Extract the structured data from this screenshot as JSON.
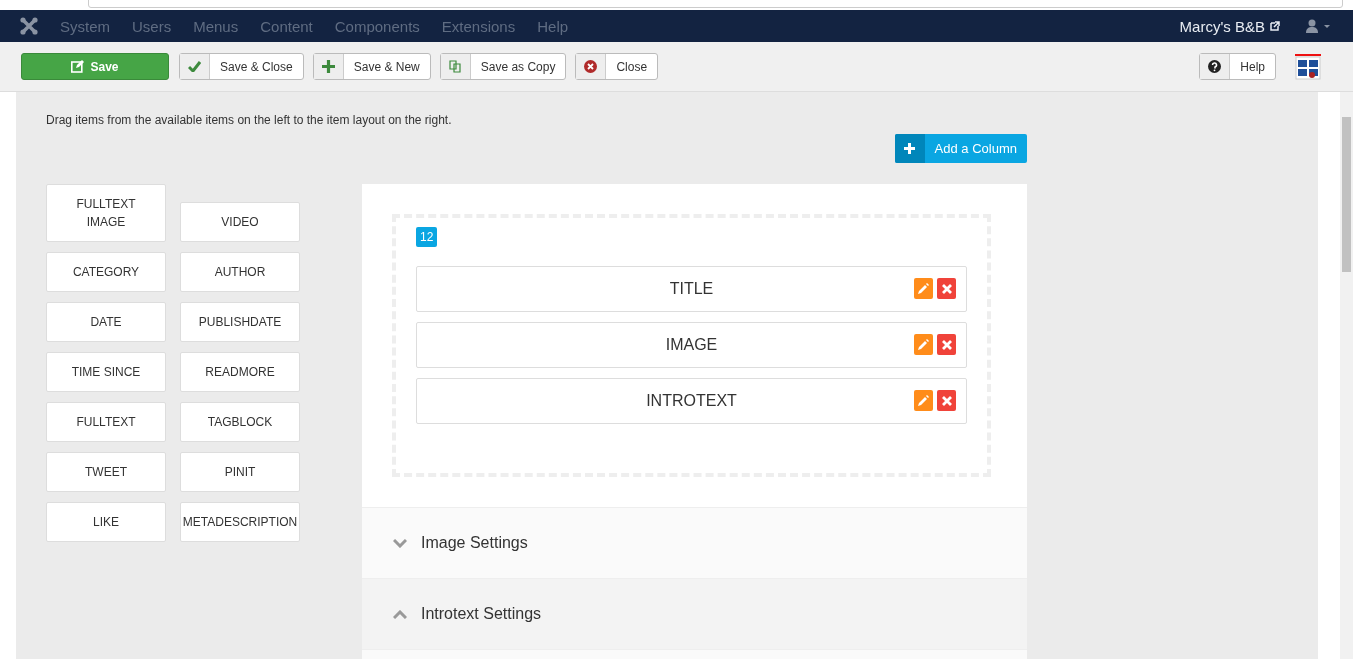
{
  "menu": {
    "items": [
      "System",
      "Users",
      "Menus",
      "Content",
      "Components",
      "Extensions",
      "Help"
    ],
    "site_link": "Marcy's B&B"
  },
  "toolbar": {
    "buttons": [
      {
        "label": "Save",
        "kind": "primary"
      },
      {
        "label": "Save & Close",
        "kind": "check"
      },
      {
        "label": "Save & New",
        "kind": "plus"
      },
      {
        "label": "Save as Copy",
        "kind": "copy"
      },
      {
        "label": "Close",
        "kind": "close"
      }
    ],
    "help": "Help"
  },
  "instructions": "Drag items from the available items on the left to the item layout on the right.",
  "add_column": "Add a Column",
  "available_items": [
    "FULLTEXT IMAGE",
    "VIDEO",
    "CATEGORY",
    "AUTHOR",
    "DATE",
    "PUBLISHDATE",
    "TIME SINCE",
    "READMORE",
    "FULLTEXT",
    "TAGBLOCK",
    "TWEET",
    "PINIT",
    "LIKE",
    "METADESCRIPTION"
  ],
  "layout": {
    "column_size": "12",
    "items": [
      "TITLE",
      "IMAGE",
      "INTROTEXT"
    ]
  },
  "sections": [
    {
      "title": "Image Settings",
      "expanded": false
    },
    {
      "title": "Introtext Settings",
      "expanded": true
    }
  ]
}
